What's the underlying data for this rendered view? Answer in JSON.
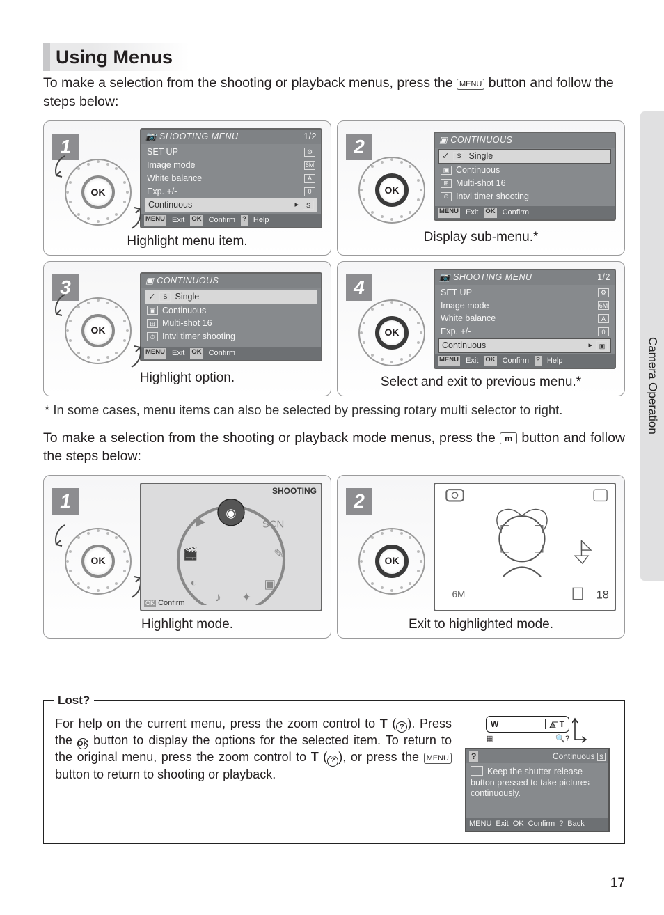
{
  "title": "Using Menus",
  "intro": "To make a selection from the shooting or playback menus, press the MENU button and follow the steps below:",
  "menu_btn": "MENU",
  "mode_btn": "m",
  "side_tab": "Camera Operation",
  "steps_a": {
    "s1": {
      "num": "1",
      "caption": "Highlight menu item.",
      "lcd_title": "SHOOTING MENU",
      "lcd_page": "1/2",
      "rows": [
        "SET UP",
        "Image mode",
        "White balance",
        "Exp. +/-",
        "Continuous"
      ],
      "hl_index": 4,
      "foot": [
        "MENU",
        "Exit",
        "OK",
        "Confirm",
        "?",
        "Help"
      ]
    },
    "s2": {
      "num": "2",
      "caption": "Display sub-menu.*",
      "lcd_title": "CONTINUOUS",
      "rows": [
        "Single",
        "Continuous",
        "Multi-shot 16",
        "Intvl timer shooting"
      ],
      "hl_index": 0,
      "foot": [
        "MENU",
        "Exit",
        "OK",
        "Confirm"
      ]
    },
    "s3": {
      "num": "3",
      "caption": "Highlight option.",
      "lcd_title": "CONTINUOUS",
      "rows": [
        "Single",
        "Continuous",
        "Multi-shot 16",
        "Intvl timer shooting"
      ],
      "hl_index": 0,
      "foot": [
        "MENU",
        "Exit",
        "OK",
        "Confirm"
      ]
    },
    "s4": {
      "num": "4",
      "caption": "Select and exit to previous menu.*",
      "lcd_title": "SHOOTING MENU",
      "lcd_page": "1/2",
      "rows": [
        "SET UP",
        "Image mode",
        "White balance",
        "Exp. +/-",
        "Continuous"
      ],
      "hl_index": 4,
      "foot": [
        "MENU",
        "Exit",
        "OK",
        "Confirm",
        "?",
        "Help"
      ]
    }
  },
  "footnote": "*  In some cases, menu items can also be selected by pressing rotary multi selector to right.",
  "intro2": "To make a selection from the shooting or playback mode menus, press the m button and follow the steps below:",
  "steps_b": {
    "s1": {
      "num": "1",
      "caption": "Highlight mode.",
      "lcd_label": "SHOOTING",
      "foot_confirm": "Confirm",
      "foot_ok": "OK"
    },
    "s2": {
      "num": "2",
      "caption": "Exit to highlighted mode.",
      "counter": "18"
    }
  },
  "lost": {
    "title": "Lost?",
    "text_parts": {
      "a": "For help on the current menu, press the zoom control to ",
      "b": " (",
      "c": ").  Press the ",
      "d": " button to display the options for the selected item.  To return to the original menu, press the zoom control to ",
      "e": " (",
      "f": "), or press the ",
      "g": " button to return to shooting or playback."
    },
    "T": "T",
    "zoom_w": "W",
    "zoom_t": "T",
    "help_title_left": "?",
    "help_title_right": "Continuous",
    "help_body": "Keep the shutter-release button pressed to take pictures continuously.",
    "help_foot": [
      "MENU",
      "Exit",
      "OK",
      "Confirm",
      "?",
      "Back"
    ]
  },
  "page_number": "17",
  "ok_label": "OK"
}
